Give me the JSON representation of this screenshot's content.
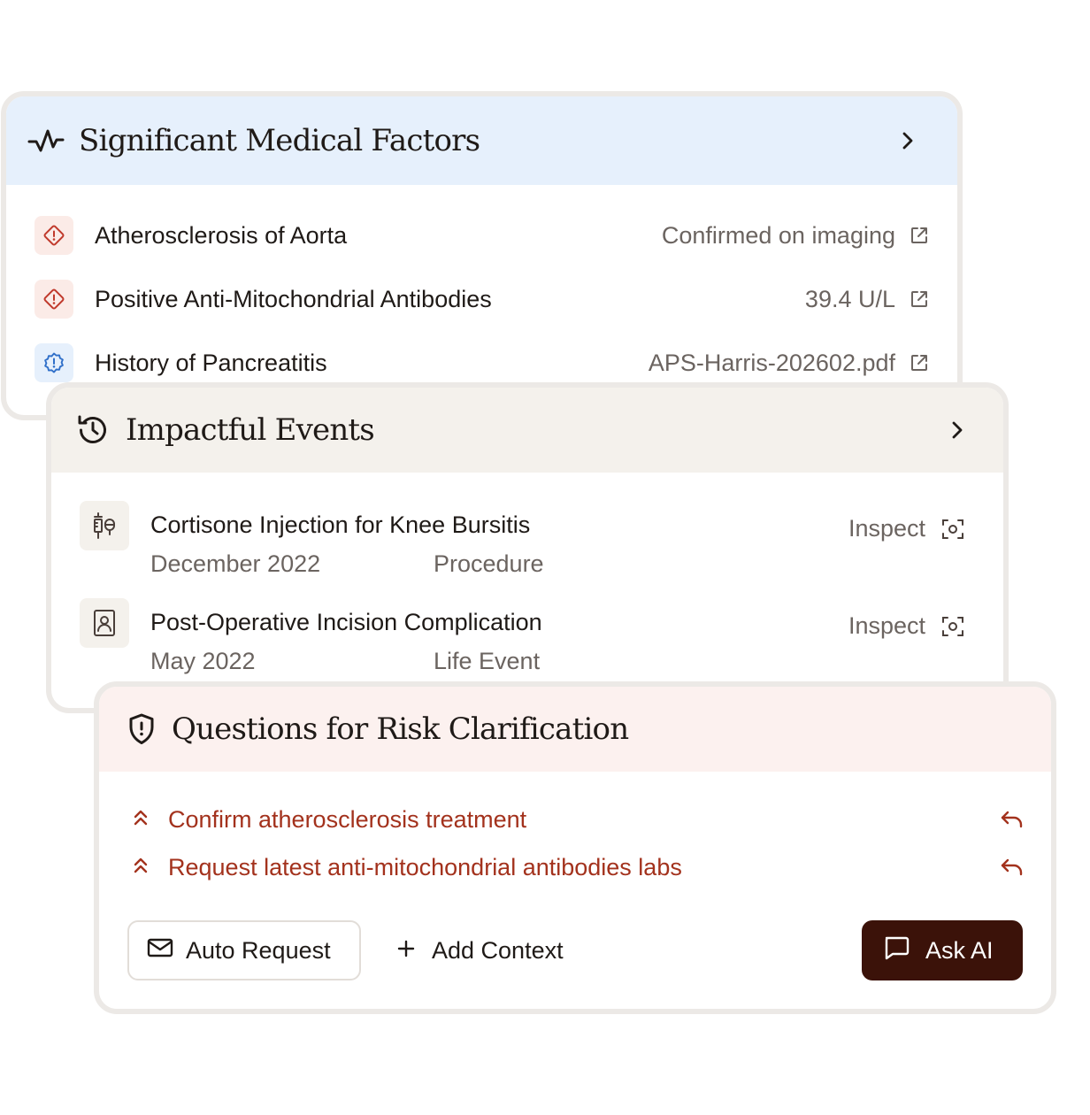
{
  "significant_factors": {
    "title": "Significant Medical Factors",
    "items": [
      {
        "name": "Atherosclerosis of Aorta",
        "value": "Confirmed on imaging",
        "severity": "high",
        "icon": "diamond-alert-icon"
      },
      {
        "name": "Positive Anti-Mitochondrial Antibodies",
        "value": "39.4 U/L",
        "severity": "high",
        "icon": "diamond-alert-icon"
      },
      {
        "name": "History of Pancreatitis",
        "value": "APS-Harris-202602.pdf",
        "severity": "info",
        "icon": "badge-alert-icon"
      }
    ]
  },
  "impactful_events": {
    "title": "Impactful Events",
    "items": [
      {
        "title": "Cortisone Injection for Knee Bursitis",
        "date": "December 2022",
        "type": "Procedure",
        "action": "Inspect",
        "icon": "syringe-icon"
      },
      {
        "title": "Post-Operative Incision Complication",
        "date": "May 2022",
        "type": "Life Event",
        "action": "Inspect",
        "icon": "contact-card-icon"
      }
    ]
  },
  "risk_questions": {
    "title": "Questions for Risk Clarification",
    "items": [
      {
        "text": "Confirm atherosclerosis treatment"
      },
      {
        "text": "Request latest anti-mitochondrial antibodies labs"
      }
    ],
    "actions": {
      "auto_request": "Auto Request",
      "add_context": "Add Context",
      "ask_ai": "Ask AI"
    }
  },
  "colors": {
    "factors_header": "#e6f0fc",
    "events_header": "#f4f1ec",
    "questions_header": "#fcf1ef",
    "alert_red": "#c0392b",
    "info_blue": "#2f6fc9",
    "question_text": "#a3321d",
    "ask_ai_bg": "#3b1209"
  }
}
